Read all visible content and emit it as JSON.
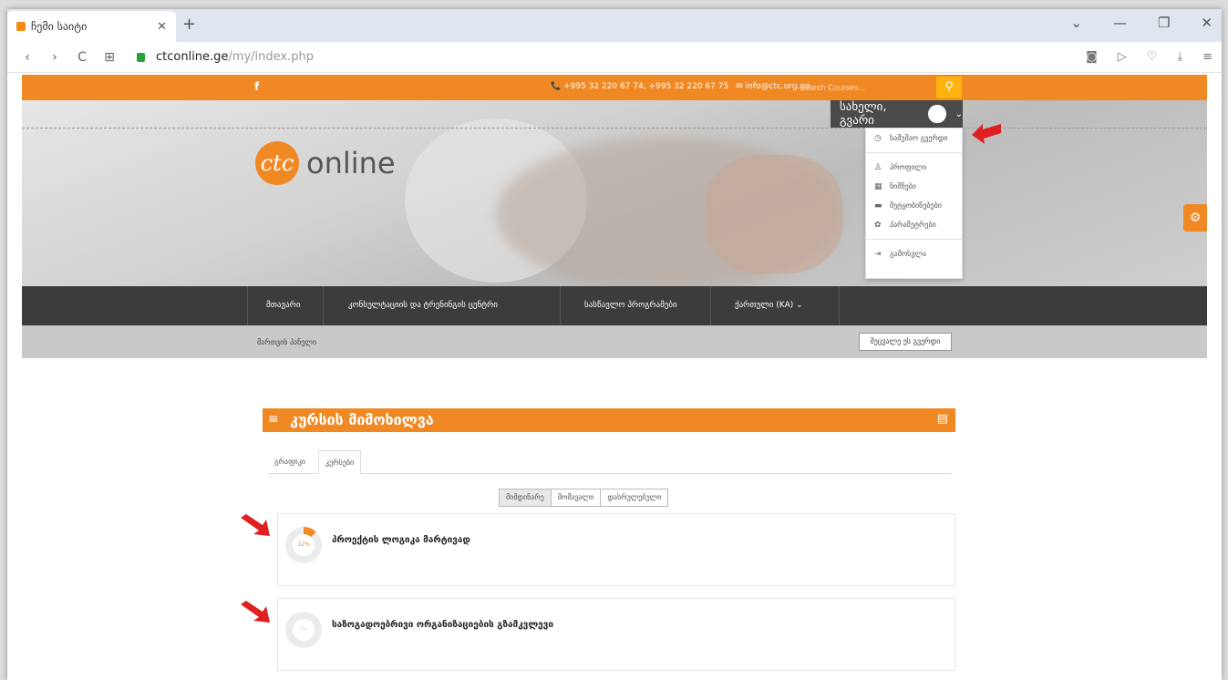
{
  "browser": {
    "tab_title": "ჩემი საიტი",
    "tab_close": "✕",
    "new_tab": "+",
    "controls": [
      "⌄",
      "—",
      "❐",
      "✕"
    ],
    "back": "‹",
    "forward": "›",
    "reload": "C",
    "apps": "⊞",
    "url_domain": "ctconline.ge",
    "url_path": "/my/index.php",
    "right_icons": [
      "◙",
      "▷",
      "♡",
      "⤓",
      "≡"
    ]
  },
  "topbar": {
    "facebook": "f",
    "phone": "📞 +995 32 220 67 74, +995 32 220 67 75",
    "email": "✉ info@ctc.org.ge",
    "search_placeholder": "Search Courses...",
    "search_icon": "⚲"
  },
  "logo": {
    "mark": "ctc",
    "word": "online"
  },
  "user": {
    "name": "სახელი, გვარი",
    "caret": "⌄"
  },
  "user_menu": {
    "items": [
      {
        "icon": "◷",
        "label": "სამუშაო გვერდი"
      },
      {
        "icon": "♙",
        "label": "პროფილი"
      },
      {
        "icon": "▦",
        "label": "ნიშნები"
      },
      {
        "icon": "▬",
        "label": "შეტყობინებები"
      },
      {
        "icon": "✿",
        "label": "პარამეტრები"
      },
      {
        "icon": "⇥",
        "label": "გამოსვლა"
      }
    ]
  },
  "gear": "⚙",
  "nav": {
    "items": [
      "მთავარი",
      "კონსულტაციის და ტრენინგის ცენტრი",
      "სასწავლო პროგრამები",
      "ქართული (KA) ⌄"
    ]
  },
  "breadcrumb": {
    "text": "მართვის პანელი",
    "button": "შეცვალე ეს გვერდი"
  },
  "overview": {
    "title": "კურსის მიმოხილვა",
    "tabs": [
      "გრაფიკი",
      "კურსები"
    ],
    "filters": [
      "მიმდინარე",
      "მომავალი",
      "დასრულებული"
    ],
    "courses": [
      {
        "title": "პროექტის ლოგიკა მარტივად",
        "progress_label": "12%",
        "progress": 0.12
      },
      {
        "title": "საზოგადოებრივი ორგანიზაციების გზამკვლევი",
        "progress_label": "0%",
        "progress": 0
      }
    ]
  },
  "colors": {
    "accent": "#f08823",
    "dark": "#3c3c3c",
    "arrow": "#e02020"
  }
}
